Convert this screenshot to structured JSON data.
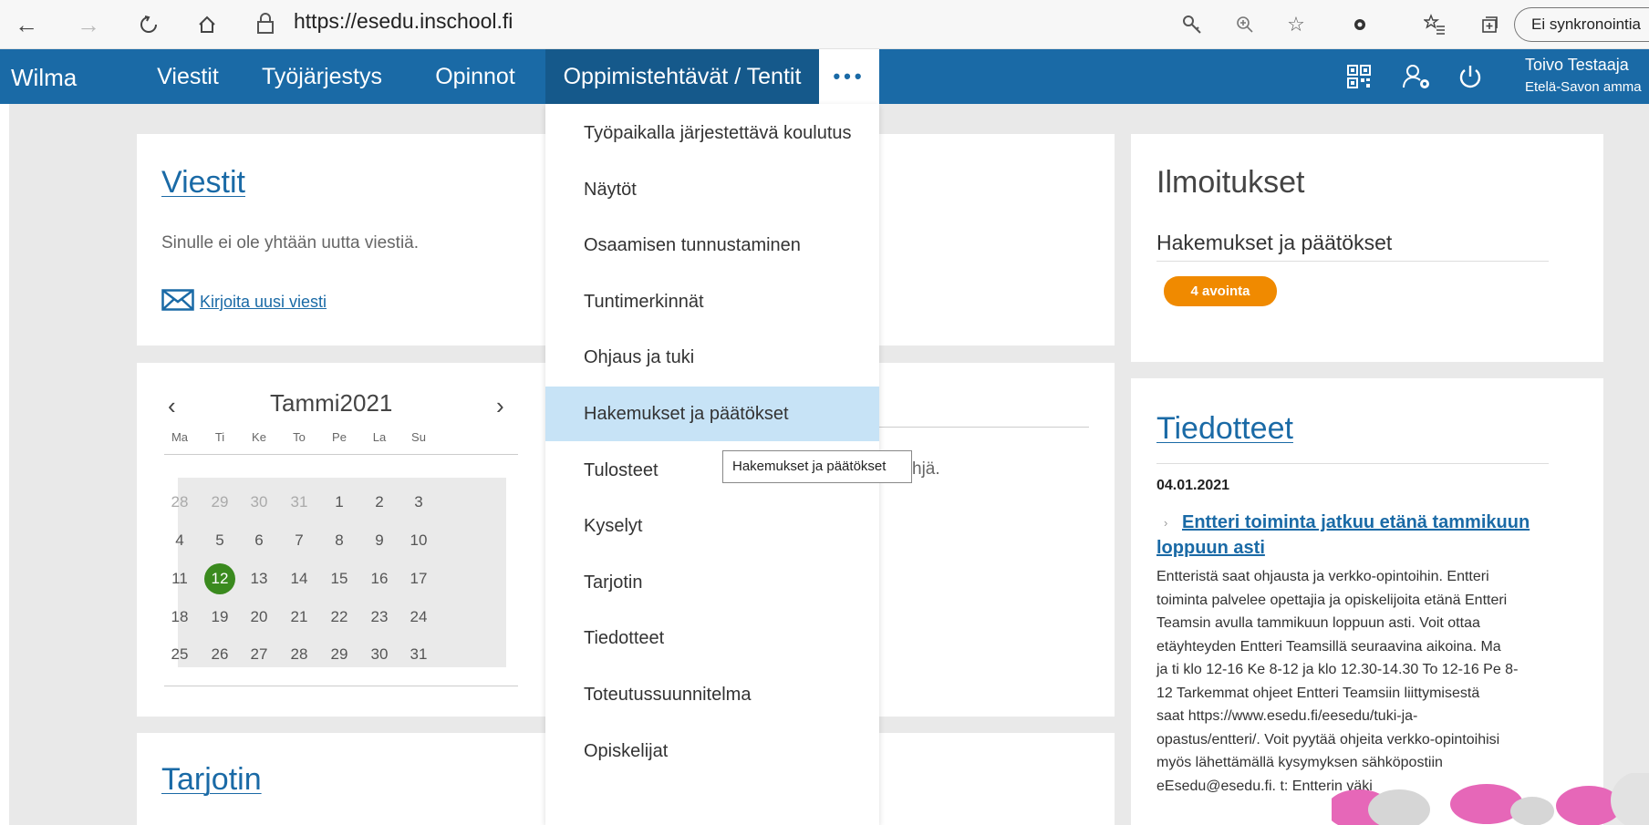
{
  "browser": {
    "url": "https://esedu.inschool.fi",
    "sync_label": "Ei synkronointia"
  },
  "header": {
    "logo": "Wilma",
    "nav": [
      "Viestit",
      "Työjärjestys",
      "Opinnot",
      "Oppimistehtävät / Tentit"
    ],
    "more": "•••",
    "user_name": "Toivo Testaaja",
    "user_school": "Etelä-Savon amma"
  },
  "messages": {
    "title": "Viestit",
    "empty_text": "Sinulle ei ole yhtään uutta viestiä.",
    "new_message_link": "Kirjoita uusi viesti"
  },
  "calendar": {
    "month_label": "Tammi2021",
    "weekdays": [
      "Ma",
      "Ti",
      "Ke",
      "To",
      "Pe",
      "La",
      "Su"
    ],
    "weeks": [
      [
        "28",
        "29",
        "30",
        "31",
        "1",
        "2",
        "3"
      ],
      [
        "4",
        "5",
        "6",
        "7",
        "8",
        "9",
        "10"
      ],
      [
        "11",
        "12",
        "13",
        "14",
        "15",
        "16",
        "17"
      ],
      [
        "18",
        "19",
        "20",
        "21",
        "22",
        "23",
        "24"
      ],
      [
        "25",
        "26",
        "27",
        "28",
        "29",
        "30",
        "31"
      ]
    ],
    "today": "12"
  },
  "middle_card": {
    "partial_text": "hjä."
  },
  "offering": {
    "title": "Tarjotin"
  },
  "dropdown": {
    "items": [
      "Työpaikalla järjestettävä koulutus",
      "Näytöt",
      "Osaamisen tunnustaminen",
      "Tuntimerkinnät",
      "Ohjaus ja tuki",
      "Hakemukset ja päätökset",
      "Tulosteet",
      "Kyselyt",
      "Tarjotin",
      "Tiedotteet",
      "Toteutussuunnitelma",
      "Opiskelijat"
    ],
    "hovered": "Hakemukset ja päätökset",
    "tooltip": "Hakemukset ja päätökset"
  },
  "notifications": {
    "title": "Ilmoitukset",
    "subtitle": "Hakemukset ja päätökset",
    "badge": "4 avointa"
  },
  "news": {
    "title": "Tiedotteet",
    "date": "04.01.2021",
    "headline_line1": "Entteri toiminta jatkuu etänä tammikuun",
    "headline_line2": "loppuun asti",
    "body_lines": [
      "Entteristä saat ohjausta ja verkko-opintoihin. Entteri",
      "toiminta palvelee opettajia ja opiskelijoita etänä Entteri",
      "Teamsin avulla tammikuun loppuun asti. Voit ottaa",
      "etäyhteyden Entteri Teamsillä seuraavina aikoina. Ma",
      "ja ti klo 12-16 Ke 8-12 ja klo 12.30-14.30 To 12-16 Pe 8-",
      "12 Tarkemmat ohjeet Entteri Teamsiin liittymisestä",
      "saat https://www.esedu.fi/eesedu/tuki-ja-",
      "opastus/entteri/. Voit pyytää ohjeita verkko-opintoihisi",
      "myös lähettämällä kysymyksen sähköpostiin",
      "eEsedu@esedu.fi. t: Entterin väki"
    ]
  },
  "colors": {
    "brand": "#1a6aa6",
    "badge": "#f08a00",
    "today": "#3a8a1e",
    "hover": "#c7e3f6"
  }
}
